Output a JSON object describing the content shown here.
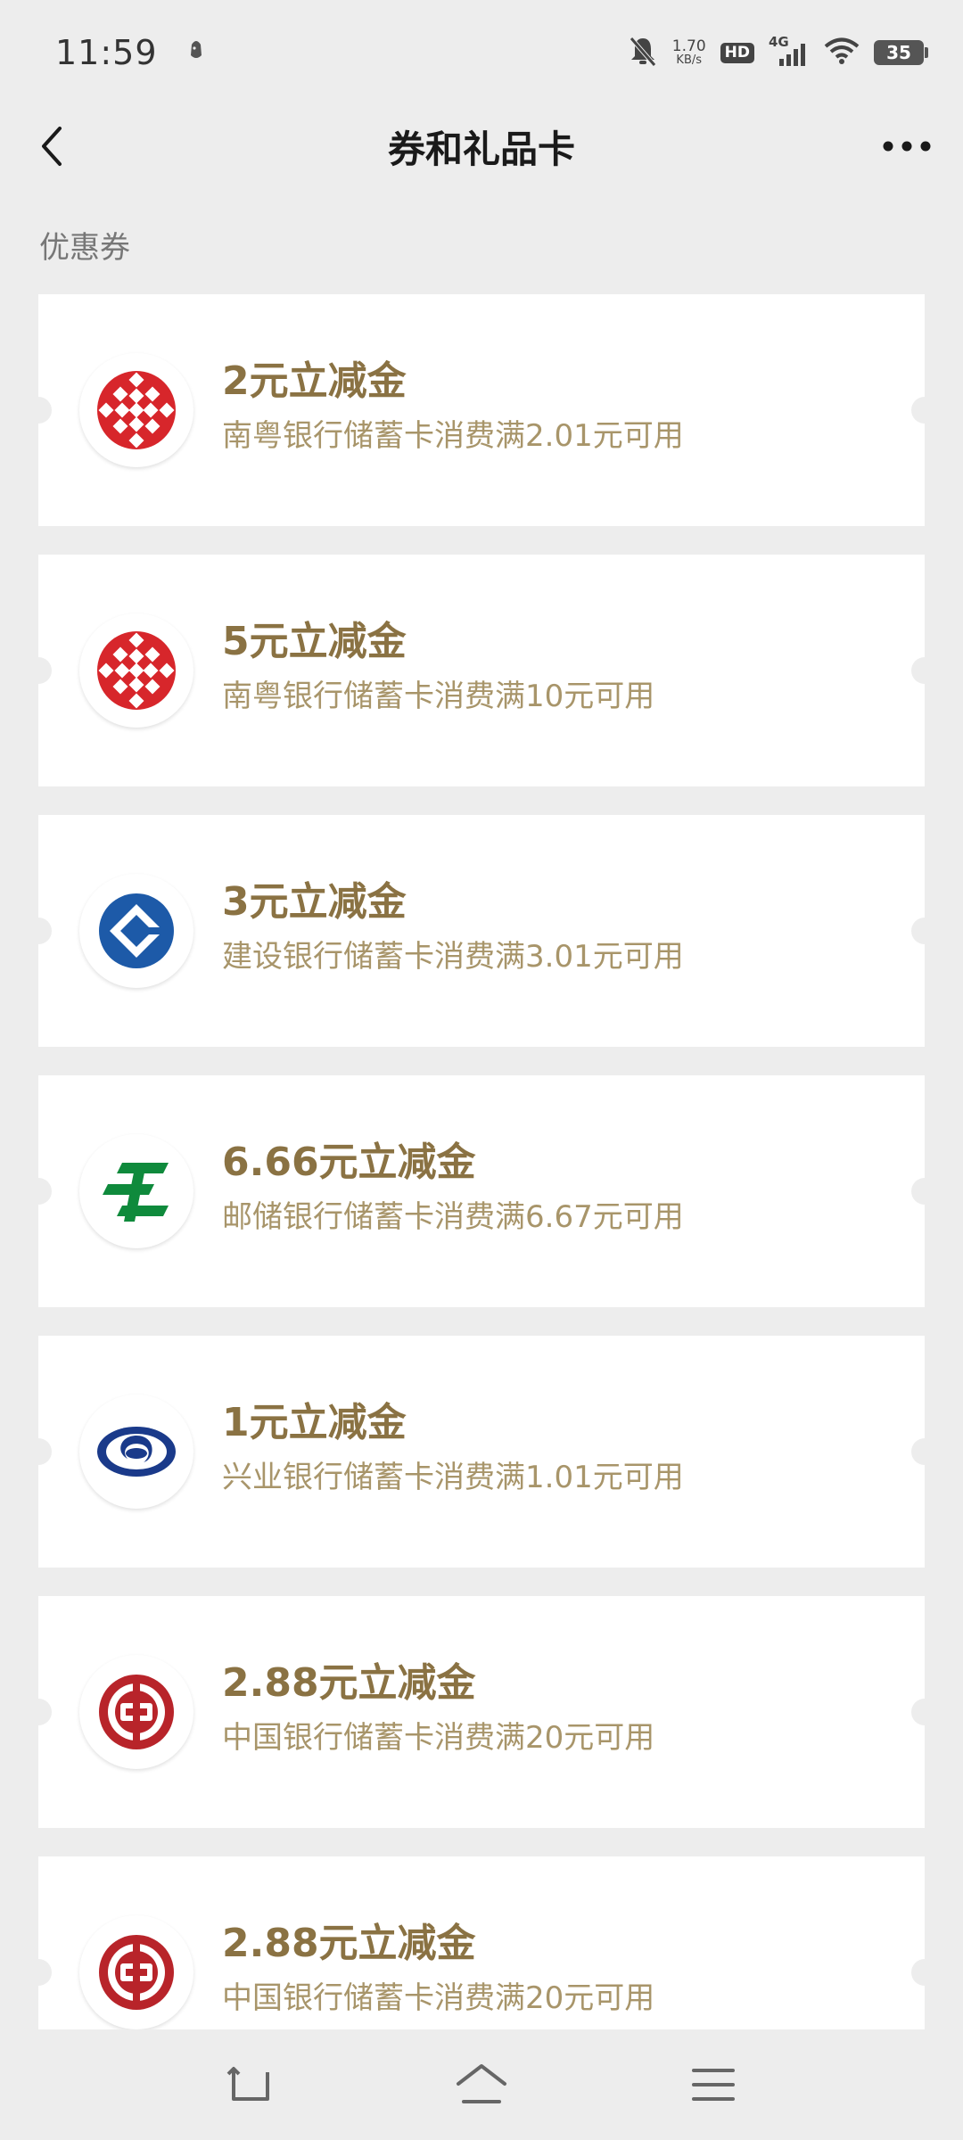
{
  "status_bar": {
    "time": "11:59",
    "net_speed_value": "1.70",
    "net_speed_unit": "KB/s",
    "hd": "HD",
    "network": "4G",
    "battery": "35"
  },
  "header": {
    "title": "券和礼品卡"
  },
  "section": {
    "label": "优惠券"
  },
  "coupons": [
    {
      "amount": "2元立减金",
      "desc": "南粤银行储蓄卡消费满2.01元可用",
      "bank_icon": "nanyue-bank-logo-icon"
    },
    {
      "amount": "5元立减金",
      "desc": "南粤银行储蓄卡消费满10元可用",
      "bank_icon": "nanyue-bank-logo-icon"
    },
    {
      "amount": "3元立减金",
      "desc": "建设银行储蓄卡消费满3.01元可用",
      "bank_icon": "ccb-logo-icon"
    },
    {
      "amount": "6.66元立减金",
      "desc": "邮储银行储蓄卡消费满6.67元可用",
      "bank_icon": "psbc-logo-icon"
    },
    {
      "amount": "1元立减金",
      "desc": "兴业银行储蓄卡消费满1.01元可用",
      "bank_icon": "cib-logo-icon"
    },
    {
      "amount": "2.88元立减金",
      "desc": "中国银行储蓄卡消费满20元可用",
      "bank_icon": "boc-logo-icon"
    },
    {
      "amount": "2.88元立减金",
      "desc": "中国银行储蓄卡消费满20元可用",
      "bank_icon": "boc-logo-icon"
    }
  ],
  "colors": {
    "background": "#ededed",
    "amount_text": "#8a7243",
    "desc_text": "#a8956a",
    "nanyue_red": "#d7262b",
    "ccb_blue": "#1d5aa8",
    "psbc_green": "#0f8a3c",
    "cib_navy": "#1a3a8a",
    "boc_red": "#b8242a"
  }
}
